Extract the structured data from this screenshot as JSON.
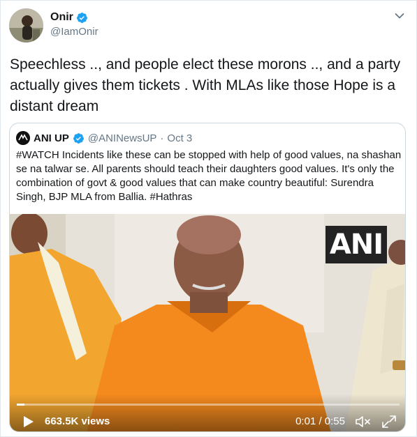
{
  "tweet": {
    "author": {
      "name": "Onir",
      "handle": "@IamOnir",
      "verified": true,
      "avatar_icon": "user-avatar-photo"
    },
    "text": "Speechless .., and people elect these morons .., and a party actually gives them tickets . With MLAs like those Hope is a distant dream",
    "menu_icon": "chevron-down-icon"
  },
  "quoted_tweet": {
    "author": {
      "name": "ANI UP",
      "handle": "@ANINewsUP",
      "verified": true,
      "date_separator": "·",
      "date": "Oct 3"
    },
    "text": "#WATCH Incidents like these can be stopped with help of good values, na shashan se na talwar se. All parents should teach their daughters good values. It's only the combination of govt & good values that can make country beautiful: Surendra Singh, BJP MLA from Ballia.  #Hathras",
    "video": {
      "watermark": "ANI",
      "views": "663.5K views",
      "timecode": "0:01 / 0:55",
      "progress_fraction": 0.02,
      "icons": [
        "play-icon",
        "mute-icon",
        "fullscreen-icon"
      ]
    }
  },
  "colors": {
    "text_primary": "#14171a",
    "text_secondary": "#657786",
    "verified_blue": "#1da1f2",
    "border": "#ccd6dd"
  }
}
